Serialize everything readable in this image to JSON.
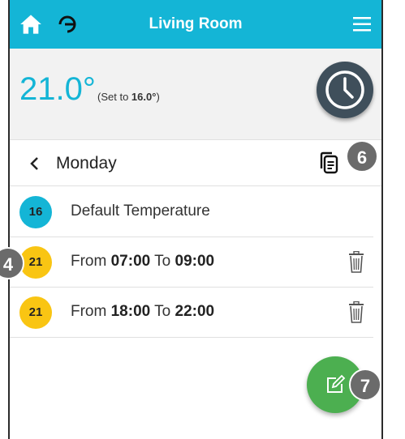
{
  "header": {
    "title": "Living Room",
    "icons": {
      "home": "home-icon",
      "sync": "sync-icon",
      "menu": "menu-icon"
    }
  },
  "status": {
    "current_temp": "21.0°",
    "set_prefix": "(Set to ",
    "set_value": "16.0°",
    "set_suffix": ")"
  },
  "schedule": {
    "day": "Monday",
    "default": {
      "badge": "16",
      "label": "Default Temperature"
    },
    "periods": [
      {
        "badge": "21",
        "from_label": "From ",
        "from": "07:00",
        "to_label": " To ",
        "to": "09:00"
      },
      {
        "badge": "21",
        "from_label": "From ",
        "from": "18:00",
        "to_label": " To ",
        "to": "22:00"
      }
    ]
  },
  "callouts": {
    "left": "4",
    "copy": "6",
    "edit": "7"
  },
  "colors": {
    "accent": "#14b5d6",
    "period_badge": "#f9c513",
    "fab": "#4caf50",
    "clock_button": "#3f4f5b",
    "callout": "#6b6b6b"
  }
}
